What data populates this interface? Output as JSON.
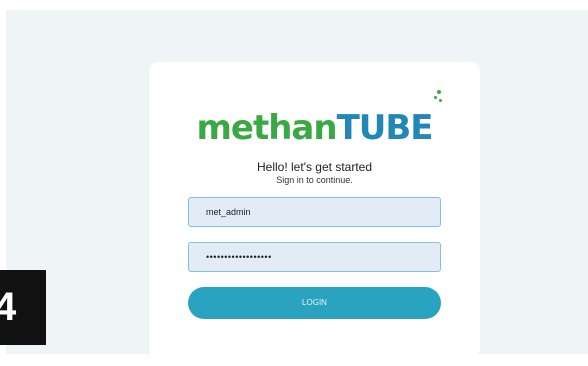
{
  "brand": {
    "logo_part1": "methan",
    "logo_part2": "TUBE",
    "colors": {
      "green": "#3aa845",
      "blue": "#2187b6",
      "button": "#2aa3c0"
    }
  },
  "login": {
    "greeting": "Hello! let's get started",
    "subtitle": "Sign in to continue.",
    "username_value": "met_admin",
    "password_value": "••••••••••••••••••",
    "login_label": "LOGIN"
  },
  "overlay": {
    "step_number": "4"
  }
}
